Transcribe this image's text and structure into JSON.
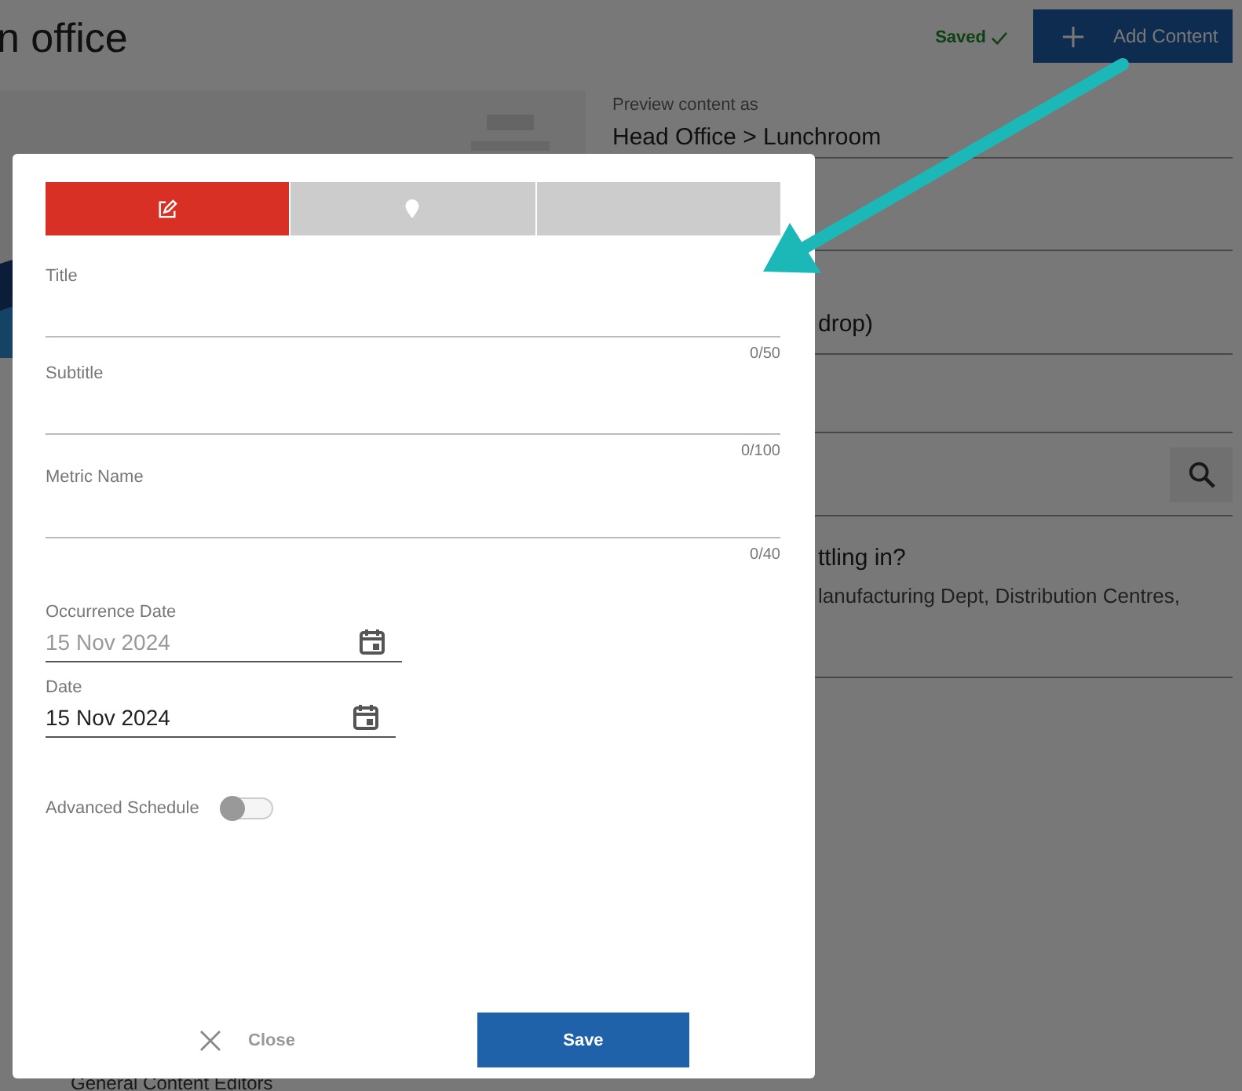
{
  "page": {
    "title": "n office",
    "saved": "Saved",
    "add_button": "Add Content",
    "preview": {
      "label": "Preview content as",
      "value": "Head Office > Lunchroom"
    },
    "fragments": [
      "drop)"
    ],
    "item": {
      "title": "ttling in?",
      "subtitle": "lanufacturing Dept, Distribution Centres,"
    },
    "footer_text": "General Content Editors"
  },
  "dialog": {
    "tabs": [
      {
        "kind": "edit",
        "selected": true
      },
      {
        "kind": "location",
        "selected": false
      },
      {
        "kind": "blank",
        "selected": false
      }
    ],
    "fields": [
      {
        "kind": "text",
        "label": "Title",
        "counter": "0/50"
      },
      {
        "kind": "text",
        "label": "Subtitle",
        "counter": "0/100"
      },
      {
        "kind": "text",
        "label": "Metric Name",
        "counter": "0/40"
      },
      {
        "kind": "date",
        "label": "Occurrence Date",
        "value": "15 Nov 2024",
        "disabled": true
      },
      {
        "kind": "date",
        "label": "Date",
        "value": "15 Nov 2024",
        "disabled": false
      }
    ],
    "toggle": {
      "label": "Advanced Schedule",
      "on": false
    },
    "close": "Close",
    "save": "Save"
  }
}
